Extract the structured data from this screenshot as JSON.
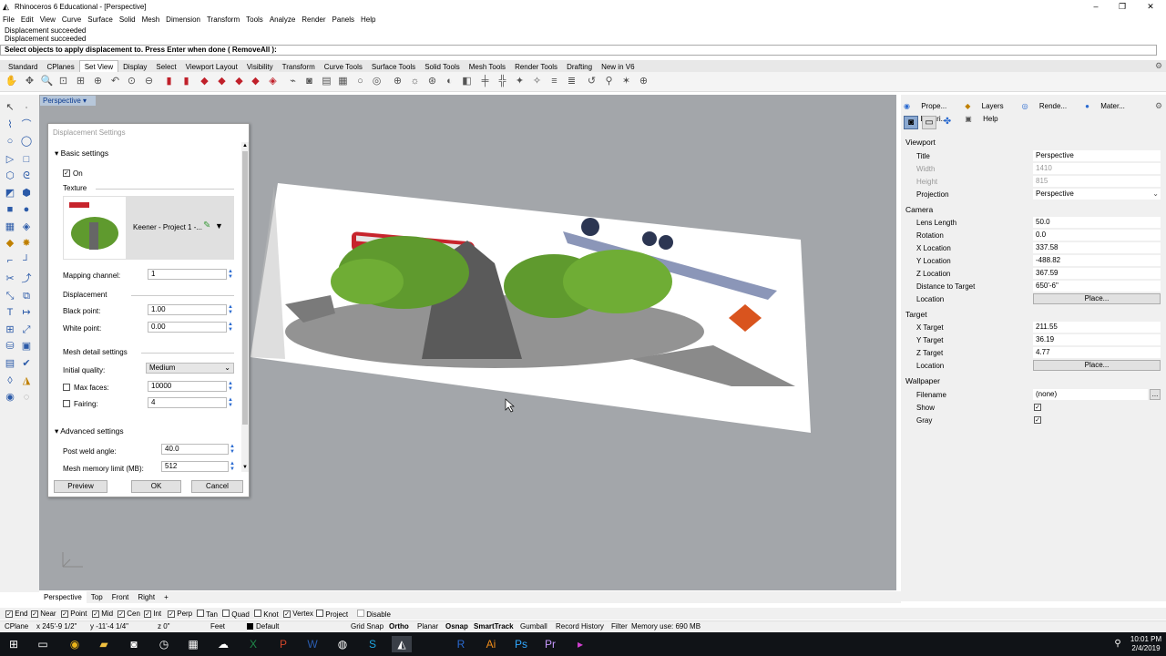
{
  "app": {
    "title": "Rhinoceros 6 Educational - [Perspective]",
    "logo": "rhino-logo-icon"
  },
  "menu": [
    "File",
    "Edit",
    "View",
    "Curve",
    "Surface",
    "Solid",
    "Mesh",
    "Dimension",
    "Transform",
    "Tools",
    "Analyze",
    "Render",
    "Panels",
    "Help"
  ],
  "command": {
    "history": [
      "Displacement succeeded",
      "Displacement succeeded"
    ],
    "prompt": "Select objects to apply displacement to. Press Enter when done ( RemoveAll ):"
  },
  "toolbar_tabs": [
    "Standard",
    "CPlanes",
    "Set View",
    "Display",
    "Select",
    "Viewport Layout",
    "Visibility",
    "Transform",
    "Curve Tools",
    "Surface Tools",
    "Solid Tools",
    "Mesh Tools",
    "Render Tools",
    "Drafting",
    "New in V6"
  ],
  "active_toolbar_tab": "Set View",
  "viewport": {
    "label": "Perspective",
    "view_tabs": [
      "Perspective",
      "Top",
      "Front",
      "Right"
    ],
    "add_tab": "+"
  },
  "dialog": {
    "title": "Displacement Settings",
    "basic_settings": "Basic settings",
    "on_label": "On",
    "texture_label": "Texture",
    "texture_name": "Keener - Project 1 -...",
    "mapping_channel_label": "Mapping channel:",
    "mapping_channel": "1",
    "displacement_label": "Displacement",
    "black_point_label": "Black point:",
    "black_point": "1.00",
    "white_point_label": "White point:",
    "white_point": "0.00",
    "mesh_detail_label": "Mesh detail settings",
    "initial_quality_label": "Initial quality:",
    "initial_quality": "Medium",
    "max_faces_label": "Max faces:",
    "max_faces": "10000",
    "fairing_label": "Fairing:",
    "fairing": "4",
    "advanced_settings": "Advanced settings",
    "post_weld_label": "Post weld angle:",
    "post_weld": "40.0",
    "mesh_memory_label": "Mesh memory limit (MB):",
    "mesh_memory": "512",
    "preview": "Preview",
    "ok": "OK",
    "cancel": "Cancel"
  },
  "panel": {
    "tabs": [
      "Prope...",
      "Layers",
      "Rende...",
      "Mater...",
      "Librari...",
      "Help"
    ],
    "viewport_section": "Viewport",
    "title_label": "Title",
    "title": "Perspective",
    "width_label": "Width",
    "width": "1410",
    "height_label": "Height",
    "height": "815",
    "projection_label": "Projection",
    "projection": "Perspective",
    "camera_section": "Camera",
    "lens_label": "Lens Length",
    "lens": "50.0",
    "rotation_label": "Rotation",
    "rotation": "0.0",
    "xloc_label": "X Location",
    "xloc": "337.58",
    "yloc_label": "Y Location",
    "yloc": "-488.82",
    "zloc_label": "Z Location",
    "zloc": "367.59",
    "dist_label": "Distance to Target",
    "dist": "650'-6\"",
    "location_label": "Location",
    "place": "Place...",
    "target_section": "Target",
    "xt_label": "X Target",
    "xt": "211.55",
    "yt_label": "Y Target",
    "yt": "36.19",
    "zt_label": "Z Target",
    "zt": "4.77",
    "wallpaper_section": "Wallpaper",
    "filename_label": "Filename",
    "filename": "(none)",
    "show_label": "Show",
    "gray_label": "Gray",
    "browse": "..."
  },
  "osnaps": [
    {
      "label": "End",
      "checked": true
    },
    {
      "label": "Near",
      "checked": true
    },
    {
      "label": "Point",
      "checked": true
    },
    {
      "label": "Mid",
      "checked": true
    },
    {
      "label": "Cen",
      "checked": true
    },
    {
      "label": "Int",
      "checked": true
    },
    {
      "label": "Perp",
      "checked": true
    },
    {
      "label": "Tan",
      "checked": false
    },
    {
      "label": "Quad",
      "checked": false
    },
    {
      "label": "Knot",
      "checked": false
    },
    {
      "label": "Vertex",
      "checked": true
    },
    {
      "label": "Project",
      "checked": false
    },
    {
      "label": "Disable",
      "checked": false
    }
  ],
  "status": {
    "cplane": "CPlane",
    "x": "x 245'-9 1/2\"",
    "y": "y -11'-4 1/4\"",
    "z": "z 0\"",
    "units": "Feet",
    "layer": "Default",
    "grid_snap": "Grid Snap",
    "ortho": "Ortho",
    "planar": "Planar",
    "osnap": "Osnap",
    "smarttrack": "SmartTrack",
    "gumball": "Gumball",
    "record": "Record History",
    "filter": "Filter",
    "memory": "Memory use: 690 MB"
  },
  "taskbar": {
    "time": "10:01 PM",
    "date": "2/4/2019"
  },
  "colors": {
    "viewport_bg": "#a3a6aa",
    "taskbar": "#101317",
    "accent": "#2a6ad0"
  }
}
